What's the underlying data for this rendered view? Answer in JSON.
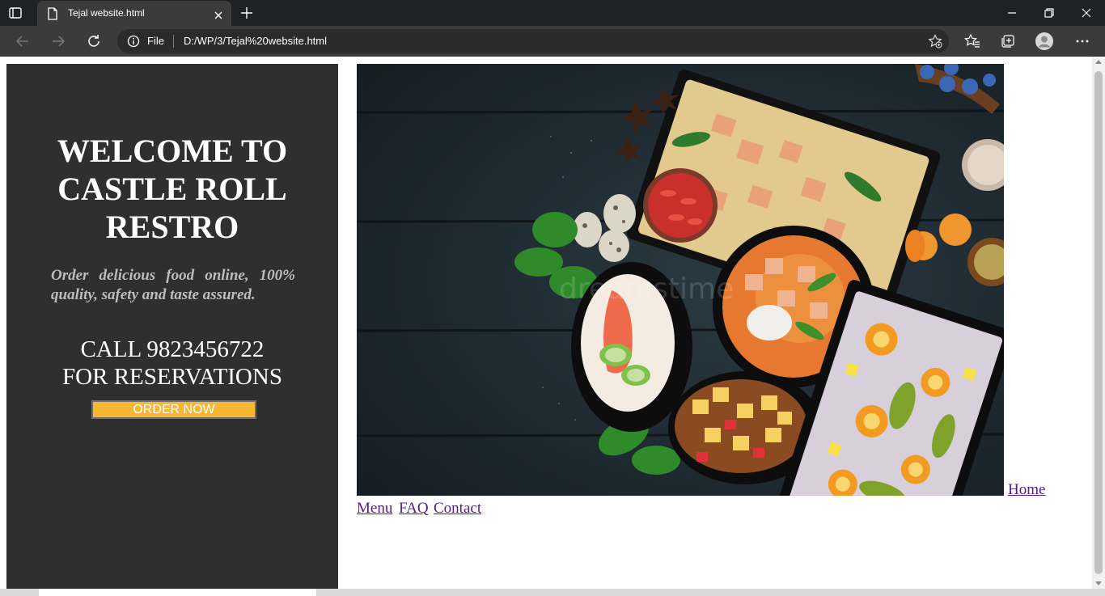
{
  "browser": {
    "tab_title": "Tejal website.html",
    "address_scheme": "File",
    "address_url": "D:/WP/3/Tejal%20website.html"
  },
  "sidebar": {
    "welcome_line1": "WELCOME TO",
    "welcome_line2": "CASTLE ROLL",
    "welcome_line3": "RESTRO",
    "tagline": "Order delicious food online, 100% quality, safety and taste assured.",
    "call_line1": "CALL 9823456722",
    "call_line2": "FOR RESERVATIONS",
    "order_button": "ORDER NOW"
  },
  "nav_links": {
    "home": "Home",
    "menu": "Menu",
    "faq": "FAQ",
    "contact": "Contact"
  },
  "hero_image": {
    "watermark": "dreamstime"
  },
  "colors": {
    "sidebar_bg": "#2f2f2f",
    "order_button_bg": "#f7b733",
    "link_visited": "#551a8b",
    "tagline_text": "#bdbdbd"
  },
  "icons": {
    "tab_actions": "tab-actions-icon",
    "favicon": "page-favicon-icon",
    "close_tab": "close-icon",
    "new_tab": "plus-icon",
    "back": "back-arrow-icon",
    "forward": "forward-arrow-icon",
    "reload": "reload-icon",
    "info": "info-icon",
    "add_favorite": "star-add-icon",
    "favorites": "favorites-icon",
    "collections": "collections-icon",
    "profile": "profile-icon",
    "more": "more-icon"
  }
}
